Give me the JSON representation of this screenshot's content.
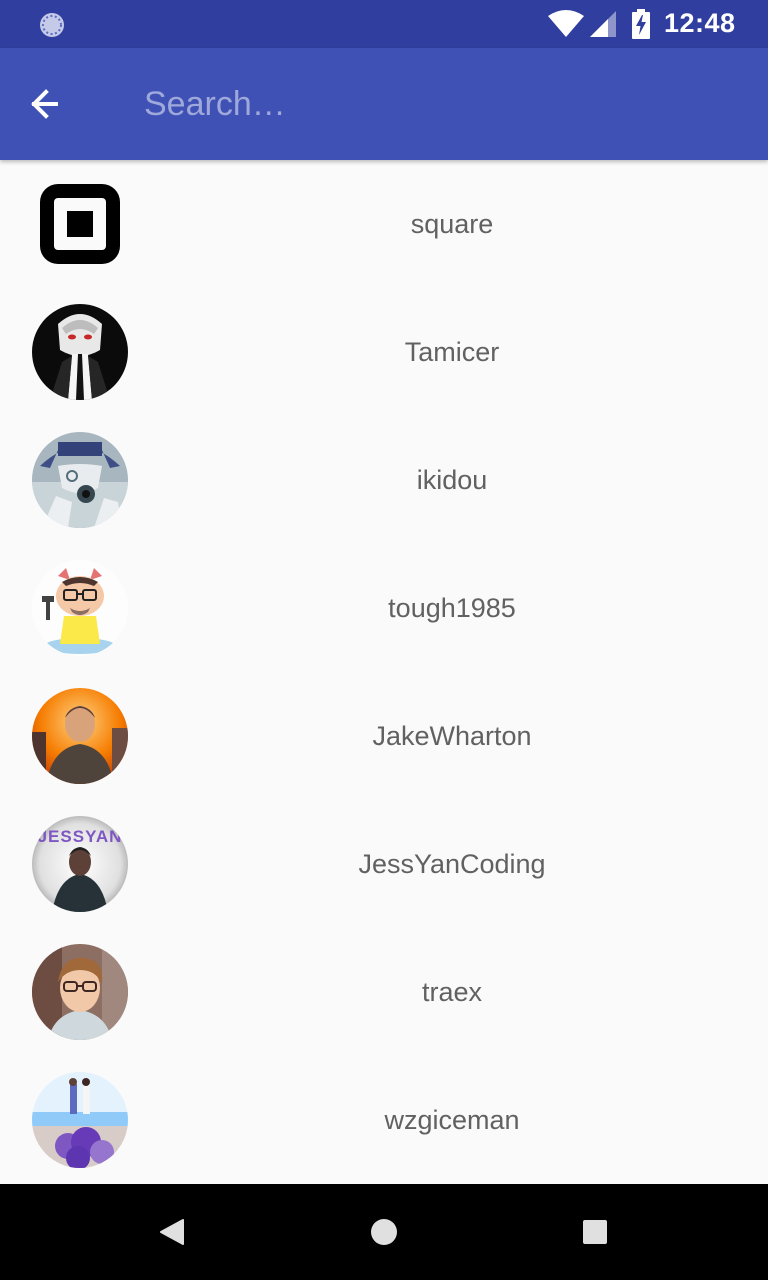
{
  "status_bar": {
    "time": "12:48",
    "icons": [
      "sync-spinner-icon",
      "wifi-icon",
      "cell-signal-icon",
      "battery-charging-icon"
    ],
    "background": "#303f9f"
  },
  "app_bar": {
    "background": "#3f51b5",
    "back_icon": "arrow-back-icon",
    "search": {
      "placeholder": "Search…",
      "value": ""
    }
  },
  "users": [
    {
      "name": "square",
      "avatar": "square-logo-icon"
    },
    {
      "name": "Tamicer",
      "avatar": "anime-character-avatar"
    },
    {
      "name": "ikidou",
      "avatar": "anime-detective-avatar"
    },
    {
      "name": "tough1985",
      "avatar": "octocat-avatar"
    },
    {
      "name": "JakeWharton",
      "avatar": "person-photo-avatar"
    },
    {
      "name": "JessYanCoding",
      "avatar": "person-photo-avatar"
    },
    {
      "name": "traex",
      "avatar": "person-photo-avatar"
    },
    {
      "name": "wzgiceman",
      "avatar": "couple-beach-photo-avatar"
    }
  ],
  "nav_bar": {
    "buttons": [
      "back-triangle-icon",
      "home-circle-icon",
      "recents-square-icon"
    ]
  }
}
